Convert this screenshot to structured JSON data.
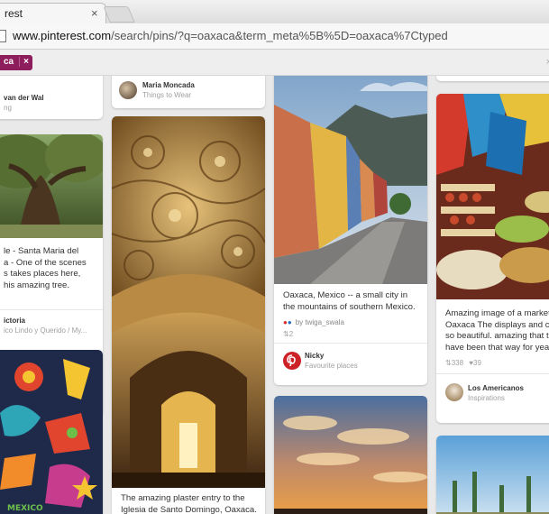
{
  "browser": {
    "tab_title": "rest",
    "tab_close": "×",
    "url_domain": "www.pinterest.com",
    "url_path": "/search/pins/?q=oaxaca&term_meta%5B%5D=oaxaca%7Ctyped"
  },
  "search": {
    "token_label": "ca",
    "token_remove": "×",
    "row_close": "×"
  },
  "pins": {
    "col1_top": {
      "name": "van der Wal",
      "sub": "ng"
    },
    "tree": {
      "desc": [
        "le - Santa Maria del",
        "a - One of the scenes",
        "s takes places here,",
        "his amazing tree."
      ],
      "name": "ictoria",
      "sub": "ico Lindo y Querido / My..."
    },
    "col2_top": {
      "name": "Maria Moncada",
      "sub": "Things to Wear"
    },
    "church": {
      "desc": [
        "The amazing plaster entry to the",
        "Iglesia de Santo Domingo, Oaxaca."
      ]
    },
    "street": {
      "desc": [
        "Oaxaca, Mexico -- a small city in",
        "the mountains of southern Mexico."
      ],
      "via_prefix": "by",
      "via_name": "twiga_swala",
      "repins": "2",
      "pinner_name": "Nicky",
      "pinner_board": "Favourite places"
    },
    "market": {
      "desc": [
        "Amazing image of a market",
        "Oaxaca The displays and c",
        "so beautiful. amazing that t",
        "have been that way for year"
      ],
      "repins": "338",
      "likes": "39",
      "pinner_name": "Los Americanos",
      "pinner_board": "Inspirations"
    }
  }
}
